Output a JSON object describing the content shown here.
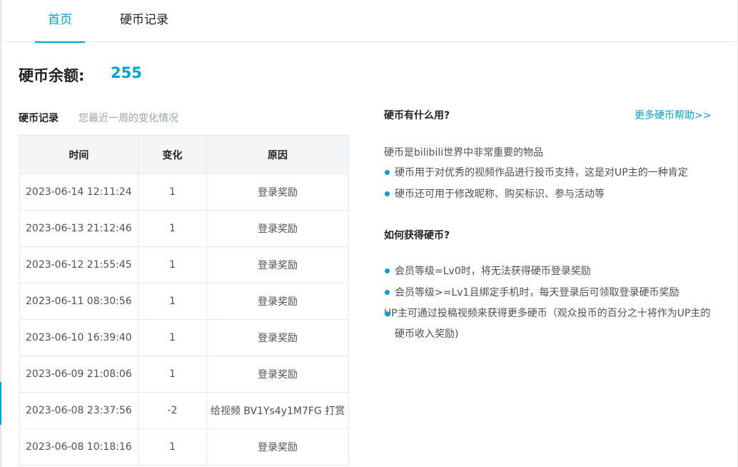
{
  "tabs": [
    {
      "label": "首页",
      "active": true
    },
    {
      "label": "硬币记录",
      "active": false
    }
  ],
  "balance": {
    "label": "硬币余额:",
    "value": "255"
  },
  "records": {
    "title": "硬币记录",
    "subtitle": "您最近一周的变化情况",
    "columns": [
      "时间",
      "变化",
      "原因"
    ],
    "rows": [
      {
        "time": "2023-06-14 12:11:24",
        "change": "1",
        "reason": "登录奖励"
      },
      {
        "time": "2023-06-13 21:12:46",
        "change": "1",
        "reason": "登录奖励"
      },
      {
        "time": "2023-06-12 21:55:45",
        "change": "1",
        "reason": "登录奖励"
      },
      {
        "time": "2023-06-11 08:30:56",
        "change": "1",
        "reason": "登录奖励"
      },
      {
        "time": "2023-06-10 16:39:40",
        "change": "1",
        "reason": "登录奖励"
      },
      {
        "time": "2023-06-09 21:08:06",
        "change": "1",
        "reason": "登录奖励"
      },
      {
        "time": "2023-06-08 23:37:56",
        "change": "-2",
        "reason": "给视频 BV1Ys4y1M7FG 打赏"
      },
      {
        "time": "2023-06-08 10:18:16",
        "change": "1",
        "reason": "登录奖励"
      }
    ]
  },
  "info": {
    "use_heading": "硬币有什么用?",
    "help_link": "更多硬币帮助>>",
    "intro": "硬币是bilibili世界中非常重要的物品",
    "use_items": [
      "硬币用于对优秀的视频作品进行投币支持，这是对UP主的一种肯定",
      "硬币还可用于修改昵称、购买标识、参与活动等"
    ],
    "get_heading": "如何获得硬币?",
    "get_items": [
      "会员等级=Lv0时，将无法获得硬币登录奖励",
      "会员等级>=Lv1且绑定手机时，每天登录后可领取登录硬币奖励",
      "UP主可通过投稿视频来获得更多硬币（观众投币的百分之十将作为UP主的硬币收入奖励)"
    ]
  },
  "colors": {
    "accent": "#00a1d6",
    "text": "#222222",
    "muted": "#99a2aa",
    "border": "#e5e9ef"
  }
}
